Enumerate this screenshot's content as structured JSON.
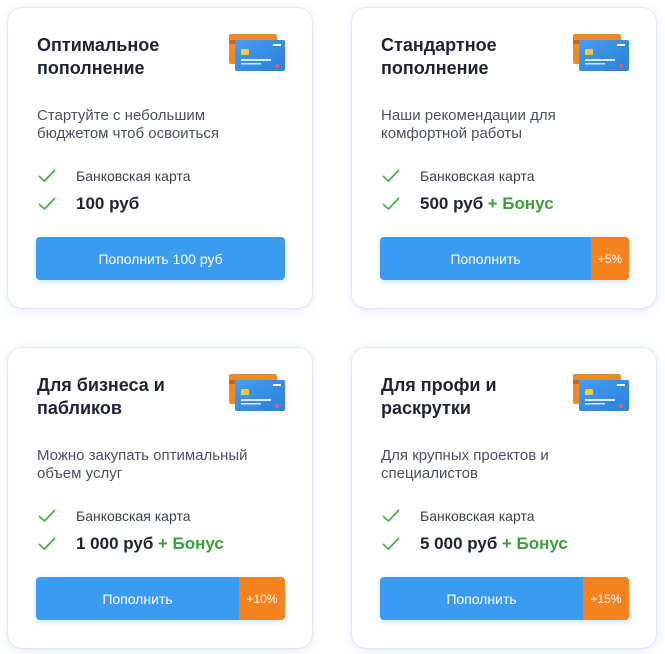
{
  "colors": {
    "accent_blue": "#3a9bf0",
    "badge_orange": "#f4831f",
    "bonus_green": "#3aa13a",
    "check_green": "#4caf50"
  },
  "cards": [
    {
      "title_lines": [
        "Оптимальное",
        "пополнение"
      ],
      "desc_lines": [
        "Стартуйте с небольшим",
        "бюджетом чтоб освоиться"
      ],
      "method": "Банковская карта",
      "amount": "100 руб",
      "bonus": "",
      "button_label": "Пополнить 100 руб",
      "badge": ""
    },
    {
      "title_lines": [
        "Стандартное",
        "пополнение"
      ],
      "desc_lines": [
        "Наши рекомендации для",
        "комфортной работы"
      ],
      "method": "Банковская карта",
      "amount": "500 руб",
      "bonus": "+ Бонус",
      "button_label": "Пополнить",
      "badge": "+5%"
    },
    {
      "title_lines": [
        "Для бизнеса и",
        "пабликов"
      ],
      "desc_lines": [
        "Можно закупать оптимальный",
        "объем услуг"
      ],
      "method": "Банковская карта",
      "amount": "1 000 руб",
      "bonus": "+ Бонус",
      "button_label": "Пополнить",
      "badge": "+10%"
    },
    {
      "title_lines": [
        "Для профи и",
        "раскрутки"
      ],
      "desc_lines": [
        "Для крупных проектов и",
        "специалистов"
      ],
      "method": "Банковская карта",
      "amount": "5 000 руб",
      "bonus": "+ Бонус",
      "button_label": "Пополнить",
      "badge": "+15%"
    }
  ],
  "icons": {
    "card": "credit-card-icon",
    "check": "check-icon"
  }
}
